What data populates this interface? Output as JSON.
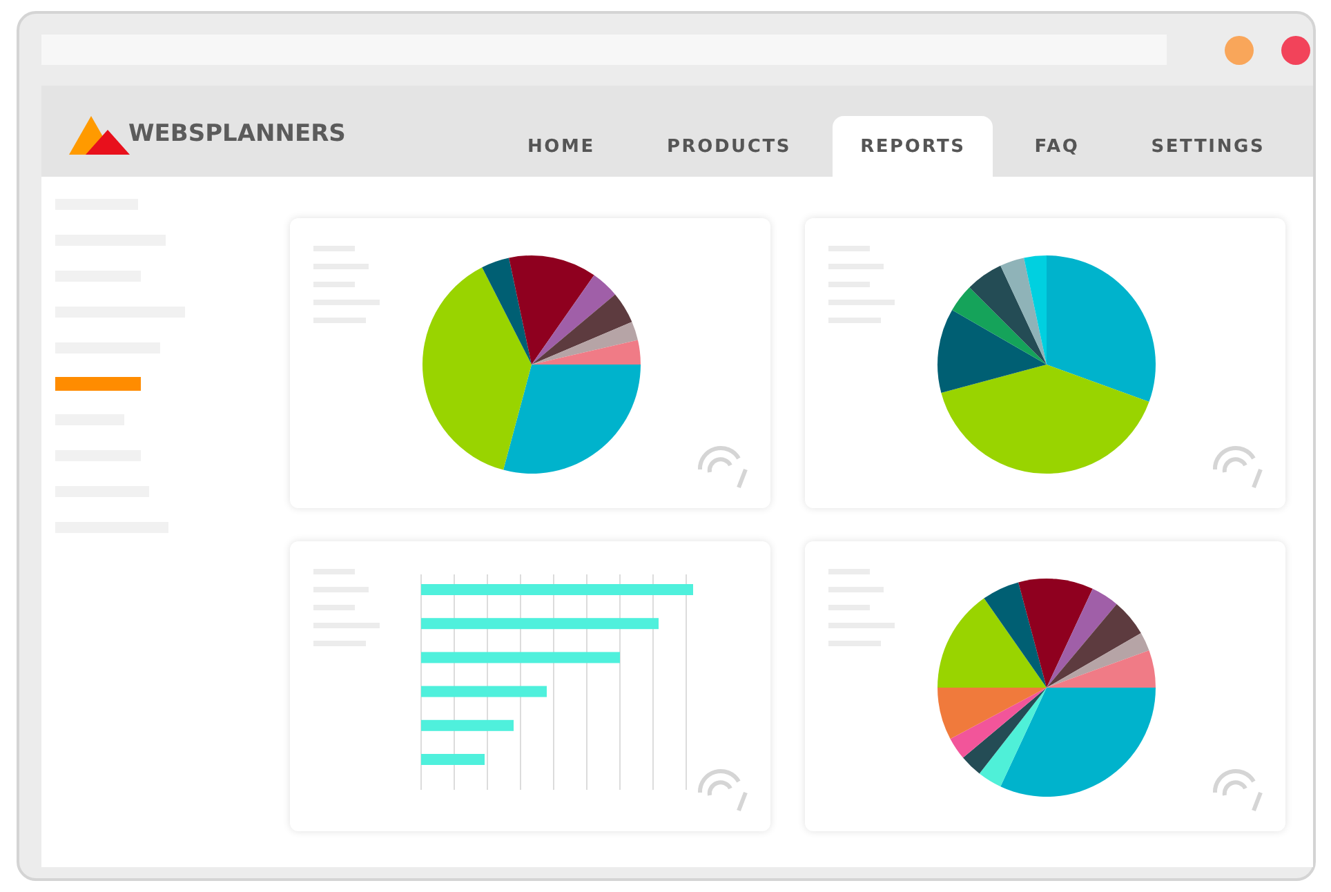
{
  "browser": {
    "dots": [
      {
        "color": "#f9a65a"
      },
      {
        "color": "#f2435a"
      }
    ]
  },
  "logo": {
    "text": "WEBSPLANNERS"
  },
  "tabs": [
    {
      "label": "HOME",
      "selected": false
    },
    {
      "label": "PRODUCTS",
      "selected": false
    },
    {
      "label": "REPORTS",
      "selected": true
    },
    {
      "label": "FAQ",
      "selected": false
    },
    {
      "label": "SETTINGS",
      "selected": false
    }
  ],
  "sidebar": {
    "items": [
      {
        "selected": false
      },
      {
        "selected": false
      },
      {
        "selected": false
      },
      {
        "selected": false
      },
      {
        "selected": false
      },
      {
        "selected": true
      },
      {
        "selected": false
      },
      {
        "selected": false
      },
      {
        "selected": false
      },
      {
        "selected": false
      }
    ]
  },
  "cards": [
    {
      "kind": "pie"
    },
    {
      "kind": "pie"
    },
    {
      "kind": "bar"
    },
    {
      "kind": "pie"
    }
  ]
}
